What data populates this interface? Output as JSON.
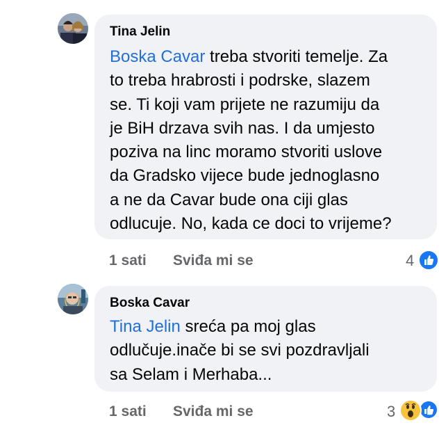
{
  "comments": [
    {
      "author": "Tina Jelin",
      "lines": [
        {
          "mention": "Boska Cavar",
          "text": " treba stvoriti temelje. Za"
        },
        {
          "text": "to treba hrabrosti i podrske, slazem"
        },
        {
          "text": "se. Ti koji vam prijete ne razumiju da"
        },
        {
          "text": "je BiH drzava svih nas. I da umjesto"
        },
        {
          "text": "poziva na linc moramo stvoriti uslove"
        },
        {
          "text": "da Gradsko vijece bude jednoglasno"
        },
        {
          "text": "a ne da Cavar bude ona ciji glas"
        },
        {
          "text": "odlucuje. No, kada ce doci to vrijeme?"
        }
      ],
      "time": "1 sati",
      "like_label": "Sviđa mi se",
      "reaction_count": "4",
      "reactions": [
        "like-icon"
      ]
    },
    {
      "author": "Boska Cavar",
      "lines": [
        {
          "mention": "Tina Jelin",
          "text": " sreća pa moj glas"
        },
        {
          "text": "odlučuje.inače bi se svi pozdravljali"
        },
        {
          "text": "sa Selam i Merhaba..."
        }
      ],
      "time": "1 sati",
      "like_label": "Sviđa mi se",
      "reaction_count": "3",
      "reactions": [
        "wow-icon",
        "like-icon"
      ]
    }
  ],
  "colors": {
    "bubble": "#f0f2f5",
    "mention": "#216fdb",
    "meta": "#65676b",
    "like": "#1877f2"
  }
}
